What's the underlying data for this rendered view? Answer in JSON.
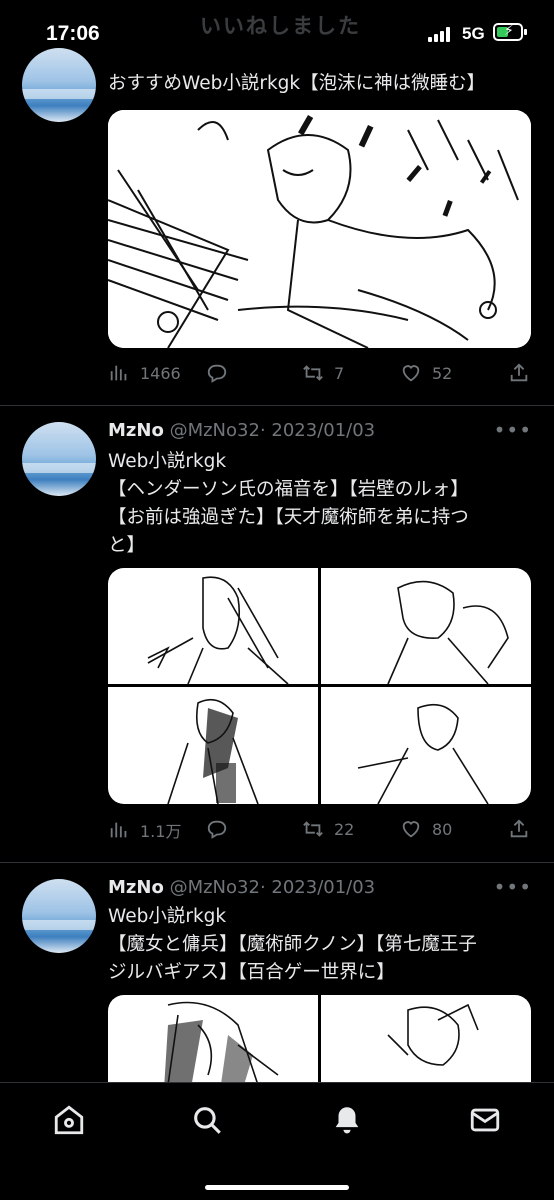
{
  "status_bar": {
    "time": "17:06",
    "network": "5G",
    "battery_color": "#34c759"
  },
  "header": {
    "ghost_title": "いいねしました"
  },
  "tweets": [
    {
      "text": "おすすめWeb小説rkgk【泡沫に神は微睡む】",
      "stats": {
        "views": "1466",
        "replies": "",
        "retweets": "7",
        "likes": "52"
      }
    },
    {
      "name": "MzNo",
      "handle": "@MzNo32",
      "date": "· 2023/01/03",
      "more": "•••",
      "text": "Web小説rkgk\n【ヘンダーソン氏の福音を】【岩壁のルォ】【お前は強過ぎた】【天才魔術師を弟に持つと】",
      "text_lines": [
        "Web小説rkgk",
        "【ヘンダーソン氏の福音を】【岩壁のルォ】",
        "【お前は強過ぎた】【天才魔術師を弟に持つ",
        "と】"
      ],
      "stats": {
        "views": "1.1万",
        "replies": "",
        "retweets": "22",
        "likes": "80"
      }
    },
    {
      "name": "MzNo",
      "handle": "@MzNo32",
      "date": "· 2023/01/03",
      "more": "•••",
      "text_lines": [
        "Web小説rkgk",
        "【魔女と傭兵】【魔術師クノン】【第七魔王子",
        "ジルバギアス】【百合ゲー世界に】"
      ]
    }
  ],
  "nav": {
    "items": [
      "home-icon",
      "search-icon",
      "notifications-icon",
      "messages-icon"
    ]
  },
  "colors": {
    "text": "#e7e9ea",
    "muted": "#71767b",
    "divider": "#2f3336",
    "background": "#000000"
  }
}
